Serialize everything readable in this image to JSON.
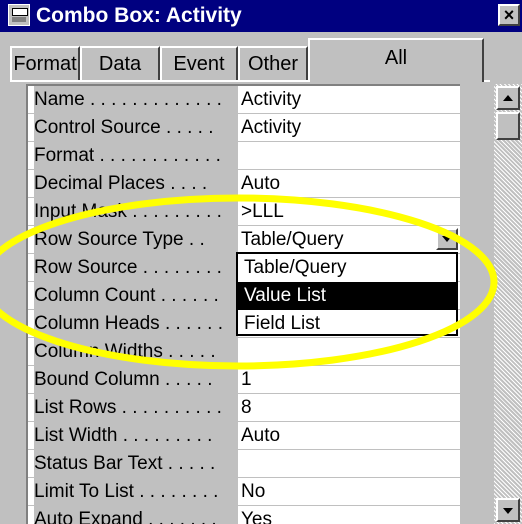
{
  "window": {
    "title": "Combo Box: Activity",
    "close_label": "×"
  },
  "tabs": [
    {
      "label": "Format",
      "active": false
    },
    {
      "label": "Data",
      "active": false
    },
    {
      "label": "Event",
      "active": false
    },
    {
      "label": "Other",
      "active": false
    },
    {
      "label": "All",
      "active": true
    }
  ],
  "properties": [
    {
      "label": "Name . . . . . . . . . . . . .",
      "value": "Activity"
    },
    {
      "label": "Control Source . . . . .",
      "value": "Activity"
    },
    {
      "label": "Format . . . . . . . . . . . .",
      "value": ""
    },
    {
      "label": "Decimal Places . . . .",
      "value": "Auto"
    },
    {
      "label": "Input Mask . . . . . . . . .",
      "value": ">LLL"
    },
    {
      "label": "Row Source Type . .",
      "value": "Table/Query"
    },
    {
      "label": "Row Source . . . . . . . .",
      "value": ""
    },
    {
      "label": "Column Count . . . . . .",
      "value": ""
    },
    {
      "label": "Column Heads . . . . . .",
      "value": ""
    },
    {
      "label": "Column Widths . . . . .",
      "value": ""
    },
    {
      "label": "Bound Column . . . . .",
      "value": "1"
    },
    {
      "label": "List Rows . . . . . . . . . .",
      "value": "8"
    },
    {
      "label": "List Width . . . . . . . . .",
      "value": "Auto"
    },
    {
      "label": "Status Bar Text . . . . .",
      "value": ""
    },
    {
      "label": "Limit To List . . . . . . . .",
      "value": "No"
    },
    {
      "label": "Auto Expand . . . . . . .",
      "value": "Yes"
    }
  ],
  "dropdown": {
    "options": [
      "Table/Query",
      "Value List",
      "Field List"
    ],
    "selected": "Value List"
  },
  "annotation": {
    "color": "#ffff00"
  },
  "colors": {
    "titlebar": "#000080",
    "face": "#c0c0c0",
    "selection": "#000000"
  }
}
